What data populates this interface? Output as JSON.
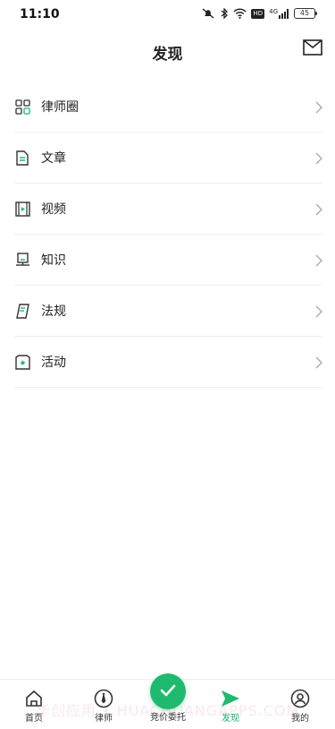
{
  "status_bar": {
    "time": "11:10",
    "battery": "45",
    "network": "4G",
    "hd": "HD"
  },
  "header": {
    "title": "发现"
  },
  "menu": {
    "items": [
      {
        "label": "律师圈",
        "icon": "grid-icon"
      },
      {
        "label": "文章",
        "icon": "document-icon"
      },
      {
        "label": "视频",
        "icon": "film-icon"
      },
      {
        "label": "知识",
        "icon": "monitor-icon"
      },
      {
        "label": "法规",
        "icon": "book-icon"
      },
      {
        "label": "活动",
        "icon": "activity-box-icon"
      }
    ]
  },
  "tabs": [
    {
      "label": "首页",
      "icon": "home-icon"
    },
    {
      "label": "律师",
      "icon": "lawyer-tie-icon"
    },
    {
      "label": "竞价委托",
      "icon": "check-circle-icon"
    },
    {
      "label": "发现",
      "icon": "send-arrow-icon"
    },
    {
      "label": "我的",
      "icon": "user-circle-icon"
    }
  ],
  "colors": {
    "accent": "#1fba6f",
    "text": "#222222",
    "divider": "#efefef"
  },
  "watermark": "华创应用 • HUACHUANGAPPS.COM"
}
